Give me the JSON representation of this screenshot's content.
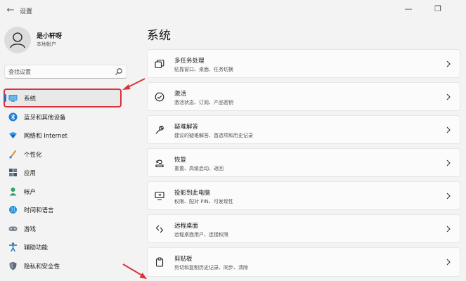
{
  "window": {
    "title": "设置",
    "back_icon": "back-arrow-icon",
    "minimize_icon": "minimize-icon",
    "maximize_icon": "maximize-icon"
  },
  "user": {
    "name": "是小轩呀",
    "account": "本地帐户"
  },
  "search": {
    "placeholder": "查找设置",
    "icon": "search-icon"
  },
  "sidebar": {
    "items": [
      {
        "label": "系统",
        "icon": "system-icon",
        "selected": true
      },
      {
        "label": "蓝牙和其他设备",
        "icon": "bluetooth-icon"
      },
      {
        "label": "网络和 Internet",
        "icon": "network-icon"
      },
      {
        "label": "个性化",
        "icon": "brush-icon"
      },
      {
        "label": "应用",
        "icon": "apps-icon"
      },
      {
        "label": "帐户",
        "icon": "account-icon"
      },
      {
        "label": "时间和语言",
        "icon": "globe-icon"
      },
      {
        "label": "游戏",
        "icon": "gamepad-icon"
      },
      {
        "label": "辅助功能",
        "icon": "accessibility-icon"
      },
      {
        "label": "隐私和安全性",
        "icon": "shield-icon"
      }
    ]
  },
  "main": {
    "title": "系统",
    "cards": [
      {
        "title": "多任务处理",
        "subtitle": "贴靠窗口、桌面、任务切换",
        "icon": "multitasking-icon"
      },
      {
        "title": "激活",
        "subtitle": "激活状态、订阅、产品密钥",
        "icon": "activation-icon"
      },
      {
        "title": "疑难解答",
        "subtitle": "建议的疑难解答、首选项和历史记录",
        "icon": "wrench-icon"
      },
      {
        "title": "恢复",
        "subtitle": "重置、高级启动、返回",
        "icon": "recovery-icon"
      },
      {
        "title": "投影到此电脑",
        "subtitle": "权限、配对 PIN、可发现性",
        "icon": "projection-icon"
      },
      {
        "title": "远程桌面",
        "subtitle": "远程桌面用户、连接权限",
        "icon": "remote-desktop-icon"
      },
      {
        "title": "剪贴板",
        "subtitle": "剪切和复制历史记录、同步、清除",
        "icon": "clipboard-icon"
      }
    ]
  },
  "colors": {
    "accent": "#2b6ec8",
    "highlight_box": "#d9333a",
    "annotation_arrow": "#d9333a"
  }
}
